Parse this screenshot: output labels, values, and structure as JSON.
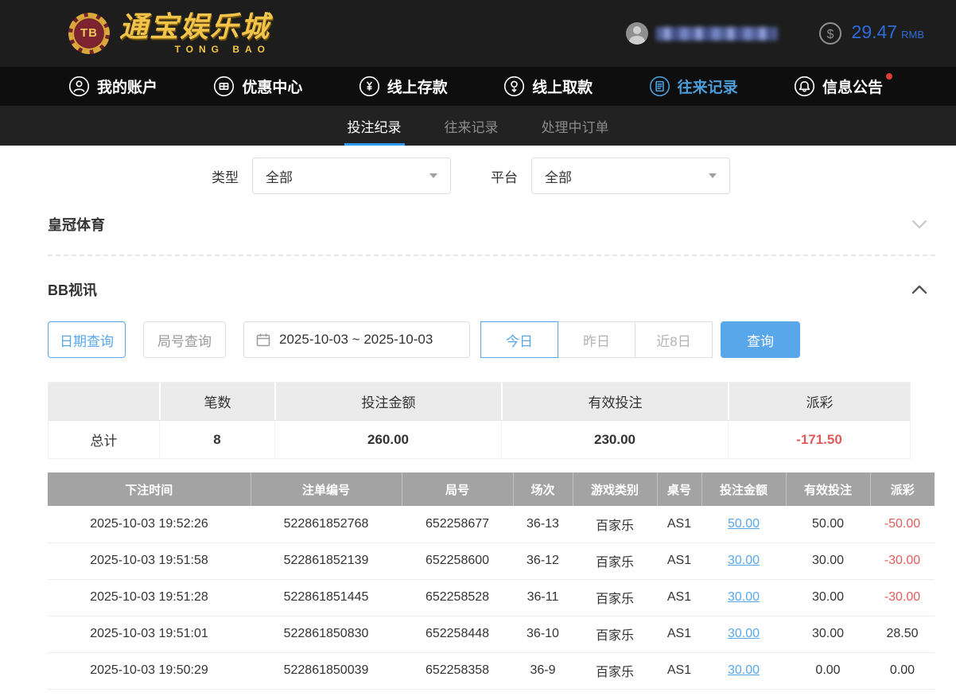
{
  "colors": {
    "accent_blue": "#2e9bf0",
    "link_blue": "#58a7ea",
    "negative_red": "#e05c5c",
    "logo_gold": "#f3c44a",
    "balance_blue": "#2d6cd8"
  },
  "header": {
    "logo": {
      "chip": "TB",
      "title": "通宝娱乐城",
      "subtitle": "TONG BAO"
    },
    "balance": {
      "amount": "29.47",
      "currency": "RMB"
    }
  },
  "nav": {
    "items": [
      {
        "id": "my-account",
        "label": "我的账户",
        "icon": "account-icon",
        "active": false,
        "badge": false
      },
      {
        "id": "promotions",
        "label": "优惠中心",
        "icon": "promo-icon",
        "active": false,
        "badge": false
      },
      {
        "id": "deposit",
        "label": "线上存款",
        "icon": "deposit-icon",
        "active": false,
        "badge": false
      },
      {
        "id": "withdraw",
        "label": "线上取款",
        "icon": "withdraw-icon",
        "active": false,
        "badge": false
      },
      {
        "id": "records",
        "label": "往来记录",
        "icon": "records-icon",
        "active": true,
        "badge": false
      },
      {
        "id": "announcements",
        "label": "信息公告",
        "icon": "bell-icon",
        "active": false,
        "badge": true
      }
    ]
  },
  "tabs": [
    {
      "id": "bet-records",
      "label": "投注纪录",
      "active": true
    },
    {
      "id": "transfer-records",
      "label": "往来记录",
      "active": false
    },
    {
      "id": "pending-orders",
      "label": "处理中订单",
      "active": false
    }
  ],
  "filters": {
    "type_label": "类型",
    "type_value": "全部",
    "platform_label": "平台",
    "platform_value": "全部"
  },
  "sections": {
    "crown_sports": {
      "title": "皇冠体育",
      "collapsed": true
    },
    "bb_video": {
      "title": "BB视讯",
      "collapsed": false
    }
  },
  "query": {
    "date_query_label": "日期查询",
    "round_query_label": "局号查询",
    "date_range": "2025-10-03 ~ 2025-10-03",
    "today_label": "今日",
    "yesterday_label": "昨日",
    "last8_label": "近8日",
    "search_label": "查询",
    "active_range": "今日"
  },
  "summary": {
    "headers": [
      "",
      "笔数",
      "投注金额",
      "有效投注",
      "派彩"
    ],
    "total": {
      "label": "总计",
      "count": "8",
      "bet_amount": "260.00",
      "valid_bet": "230.00",
      "payout": "-171.50"
    }
  },
  "bet_table": {
    "headers": [
      "下注时间",
      "注单编号",
      "局号",
      "场次",
      "游戏类别",
      "桌号",
      "投注金额",
      "有效投注",
      "派彩"
    ],
    "col_keys": [
      "bet-time",
      "order-id",
      "round-id",
      "session",
      "game-type",
      "table-id",
      "bet-amount",
      "valid-bet",
      "payout"
    ],
    "rows": [
      [
        "2025-10-03 19:52:26",
        "522861852768",
        "652258677",
        "36-13",
        "百家乐",
        "AS1",
        "50.00",
        "50.00",
        "-50.00"
      ],
      [
        "2025-10-03 19:51:58",
        "522861852139",
        "652258600",
        "36-12",
        "百家乐",
        "AS1",
        "30.00",
        "30.00",
        "-30.00"
      ],
      [
        "2025-10-03 19:51:28",
        "522861851445",
        "652258528",
        "36-11",
        "百家乐",
        "AS1",
        "30.00",
        "30.00",
        "-30.00"
      ],
      [
        "2025-10-03 19:51:01",
        "522861850830",
        "652258448",
        "36-10",
        "百家乐",
        "AS1",
        "30.00",
        "30.00",
        "28.50"
      ],
      [
        "2025-10-03 19:50:29",
        "522861850039",
        "652258358",
        "36-9",
        "百家乐",
        "AS1",
        "30.00",
        "0.00",
        "0.00"
      ]
    ]
  }
}
